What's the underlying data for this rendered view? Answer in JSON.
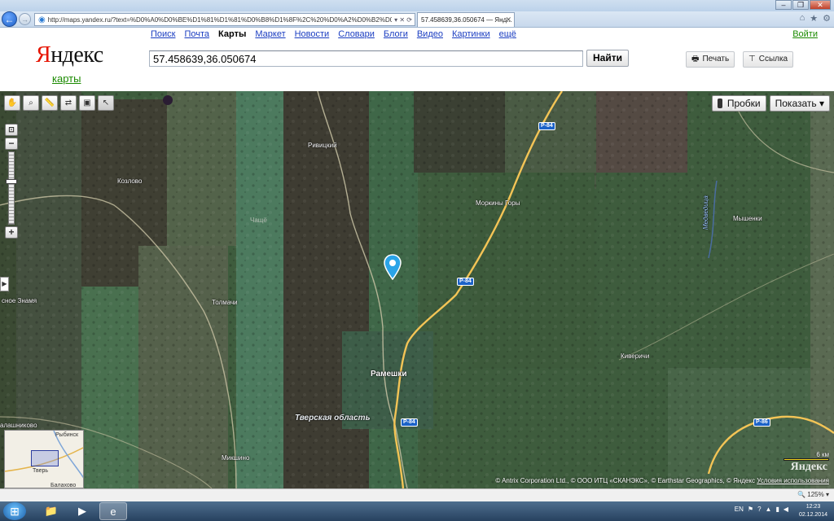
{
  "browser": {
    "url": "http://maps.yandex.ru/?text=%D0%A0%D0%BE%D1%81%D1%81%D0%B8%D1%8F%2C%20%D0%A2%D0%B2%D0%B5%D1%80",
    "tab_title": "57.458639,36.050674 — Янд...",
    "back_icon": "back-arrow-icon",
    "forward_icon": "forward-arrow-icon"
  },
  "yandex": {
    "logo": "Яндекс",
    "logo_first": "Я",
    "logo_rest": "ндекс",
    "logo_sub": "карты",
    "services": [
      "Поиск",
      "Почта",
      "Карты",
      "Маркет",
      "Новости",
      "Словари",
      "Блоги",
      "Видео",
      "Картинки",
      "ещё"
    ],
    "active_service": "Карты",
    "login": "Войти",
    "search_value": "57.458639,36.050674",
    "search_button": "Найти",
    "print_button": "Печать",
    "link_button": "Ссылка"
  },
  "map": {
    "traffic_button": "Пробки",
    "show_button": "Показать ▾",
    "labels": {
      "rivickiy": "Ривицкий",
      "kozlovo": "Козлово",
      "morkiny_gory": "Моркины Горы",
      "myshenki": "Мышенки",
      "tolmachi": "Толмачи",
      "krasnoe_znamya": "сное Знамя",
      "rameshki": "Рамешки",
      "kiverichi": "Киверичи",
      "tver_oblast": "Тверская область",
      "kalashnikovo": "алашниково",
      "mikshino": "Микшино",
      "river": "Медведица",
      "ghost_sheet": "Чащё"
    },
    "roads": [
      "Р-84",
      "Р-84",
      "Р-84",
      "Р-86"
    ],
    "scale_label": "6 км",
    "watermark": "Яндекс",
    "copyright": "© Antrix Corporation Ltd., © ООО ИТЦ «СКАНЭКС», © Earthstar Geographics, © Яндекс",
    "terms_link": "Условия использования",
    "minimap": {
      "city": "Тверь",
      "town_top": "Рыбинск",
      "town_bottom": "Балахово"
    },
    "zoom_level": 0.6
  },
  "status": {
    "zoom": "125%"
  },
  "taskbar": {
    "lang": "EN",
    "time": "12:23",
    "date": "02.12.2014"
  }
}
